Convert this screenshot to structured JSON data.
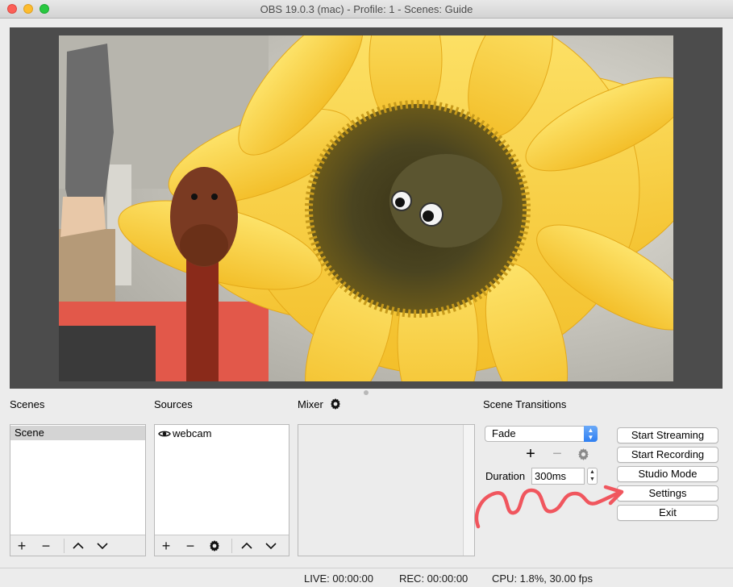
{
  "window": {
    "title": "OBS 19.0.3 (mac) - Profile: 1 - Scenes: Guide"
  },
  "docks": {
    "scenes": {
      "label": "Scenes",
      "items": [
        "Scene"
      ]
    },
    "sources": {
      "label": "Sources",
      "items": [
        {
          "name": "webcam",
          "visible": true
        }
      ]
    },
    "mixer": {
      "label": "Mixer"
    },
    "transitions": {
      "label": "Scene Transitions",
      "selected": "Fade",
      "duration_label": "Duration",
      "duration_value": "300ms"
    }
  },
  "controls": {
    "start_streaming": "Start Streaming",
    "start_recording": "Start Recording",
    "studio_mode": "Studio Mode",
    "settings": "Settings",
    "exit": "Exit"
  },
  "status": {
    "live": "LIVE: 00:00:00",
    "rec": "REC: 00:00:00",
    "cpu": "CPU: 1.8%, 30.00 fps"
  },
  "colors": {
    "accent_select": "#2e7ff2",
    "annotation_arrow": "#f0565e"
  },
  "icons": {
    "add": "plus-icon",
    "remove": "minus-icon",
    "up": "chevron-up-icon",
    "down": "chevron-down-icon",
    "gear": "gear-icon",
    "eye": "eye-icon"
  }
}
